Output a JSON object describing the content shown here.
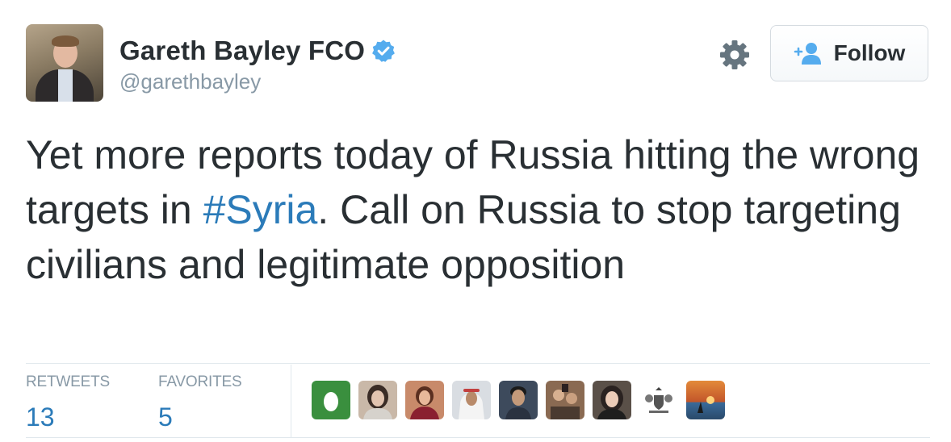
{
  "user": {
    "name": "Gareth Bayley FCO",
    "handle": "@garethbayley",
    "verified": true
  },
  "follow_button": {
    "label": "Follow",
    "icon": "person-plus-icon"
  },
  "settings": {
    "icon": "gear-icon"
  },
  "tweet": {
    "text_before": "Yet more reports today of Russia hitting the wrong targets in ",
    "hashtag": "#Syria",
    "text_after": ".  Call on Russia to stop targeting civilians and legitimate opposition"
  },
  "stats": {
    "retweets_label": "RETWEETS",
    "retweets_count": "13",
    "favorites_label": "FAVORITES",
    "favorites_count": "5"
  },
  "engager_avatars": [
    {
      "name": "avatar-egg",
      "bg": "#3a8f3e"
    },
    {
      "name": "avatar-woman-dark-hair",
      "bg": "#c9b8a8"
    },
    {
      "name": "avatar-woman-red",
      "bg": "#c88a6a"
    },
    {
      "name": "avatar-man-headdress",
      "bg": "#d9dde2"
    },
    {
      "name": "avatar-man-dark",
      "bg": "#3d4a5c"
    },
    {
      "name": "avatar-group",
      "bg": "#8a6a52"
    },
    {
      "name": "avatar-woman-blonde",
      "bg": "#5a5048"
    },
    {
      "name": "avatar-coat-of-arms",
      "bg": "#ffffff"
    },
    {
      "name": "avatar-sunset",
      "bg": "#d9783a"
    }
  ],
  "colors": {
    "text": "#292f33",
    "muted": "#8899a6",
    "link": "#2b7bb9",
    "verified": "#55acee",
    "divider": "#e1e8ed"
  }
}
